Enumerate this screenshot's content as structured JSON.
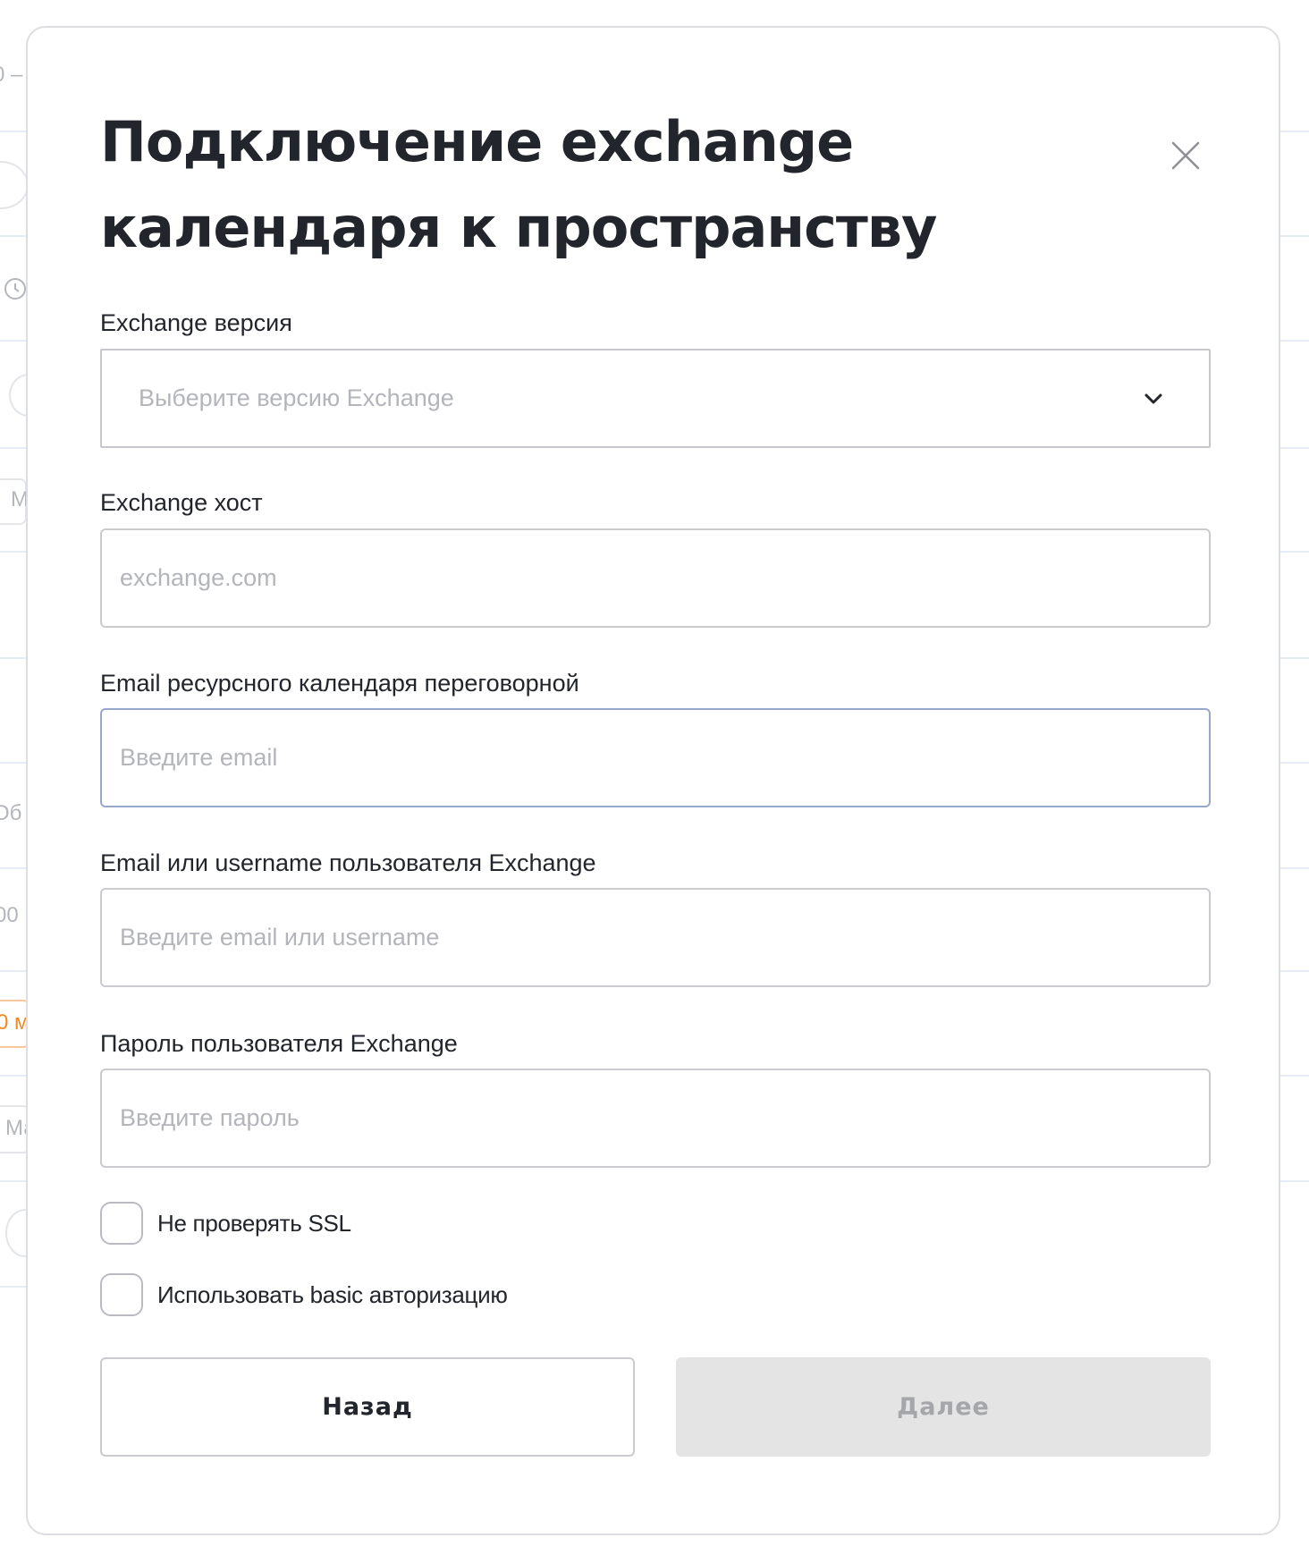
{
  "background": {
    "fragments": [
      "0 –",
      "M",
      "Об",
      "00",
      "0 м",
      "Ма"
    ]
  },
  "modal": {
    "title": "Подключение exchange календаря к пространству",
    "close_icon": "close-icon",
    "fields": {
      "version": {
        "label": "Exchange версия",
        "placeholder": "Выберите версию Exchange",
        "value": ""
      },
      "host": {
        "label": "Exchange хост",
        "placeholder": "exchange.com",
        "value": ""
      },
      "resource_email": {
        "label": "Email ресурсного календаря переговорной",
        "placeholder": "Введите email",
        "value": ""
      },
      "user": {
        "label": "Email или username пользователя Exchange",
        "placeholder": "Введите email или username",
        "value": ""
      },
      "password": {
        "label": "Пароль пользователя Exchange",
        "placeholder": "Введите пароль",
        "value": ""
      }
    },
    "checkboxes": {
      "skip_ssl": {
        "label": "Не проверять SSL",
        "checked": false
      },
      "basic_auth": {
        "label": "Использовать basic авторизацию",
        "checked": false
      }
    },
    "buttons": {
      "back": "Назад",
      "next": "Далее"
    }
  },
  "colors": {
    "text": "#22252b",
    "placeholder": "#b3b5ba",
    "border": "#c9cbcf",
    "focus_border": "#97a7cc",
    "disabled_bg": "#e4e4e5",
    "disabled_text": "#a5a6a9",
    "accent_orange": "#f08a24"
  }
}
